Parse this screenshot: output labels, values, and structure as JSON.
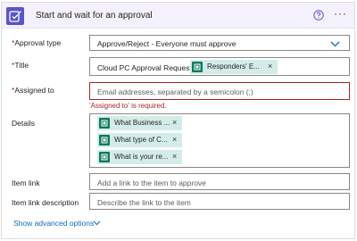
{
  "header": {
    "title": "Start and wait for an approval",
    "help_icon": "question-circle-icon",
    "more_icon": "more-horizontal-icon",
    "more_label": "···",
    "accent_color": "#5b54c9",
    "background_color": "#f4f1fd"
  },
  "fields": {
    "approval_type": {
      "label": "Approval type",
      "required_mark": "*",
      "value": "Approve/Reject - Everyone must approve"
    },
    "title": {
      "label": "Title",
      "required_mark": "*",
      "prefix_text": "Cloud PC Approval Request -",
      "token_label": "Responders' E...",
      "token_close": "×"
    },
    "assigned_to": {
      "label": "Assigned to",
      "required_mark": "*",
      "placeholder": "Email addresses, separated by a semicolon (;)",
      "error": "'Assigned to' is required."
    },
    "details": {
      "label": "Details",
      "tokens": [
        {
          "label": "What Business ...",
          "close": "×"
        },
        {
          "label": "What type of C...",
          "close": "×"
        },
        {
          "label": "What is your re...",
          "close": "×"
        }
      ]
    },
    "item_link": {
      "label": "Item link",
      "placeholder": "Add a link to the item to approve"
    },
    "item_link_description": {
      "label": "Item link description",
      "placeholder": "Describe the link to the item"
    }
  },
  "advanced": {
    "label": "Show advanced options"
  },
  "colors": {
    "error": "#a4262c",
    "link": "#0f6cbd",
    "token_bg": "#d3ecea",
    "token_icon": "#0e7a5a"
  }
}
